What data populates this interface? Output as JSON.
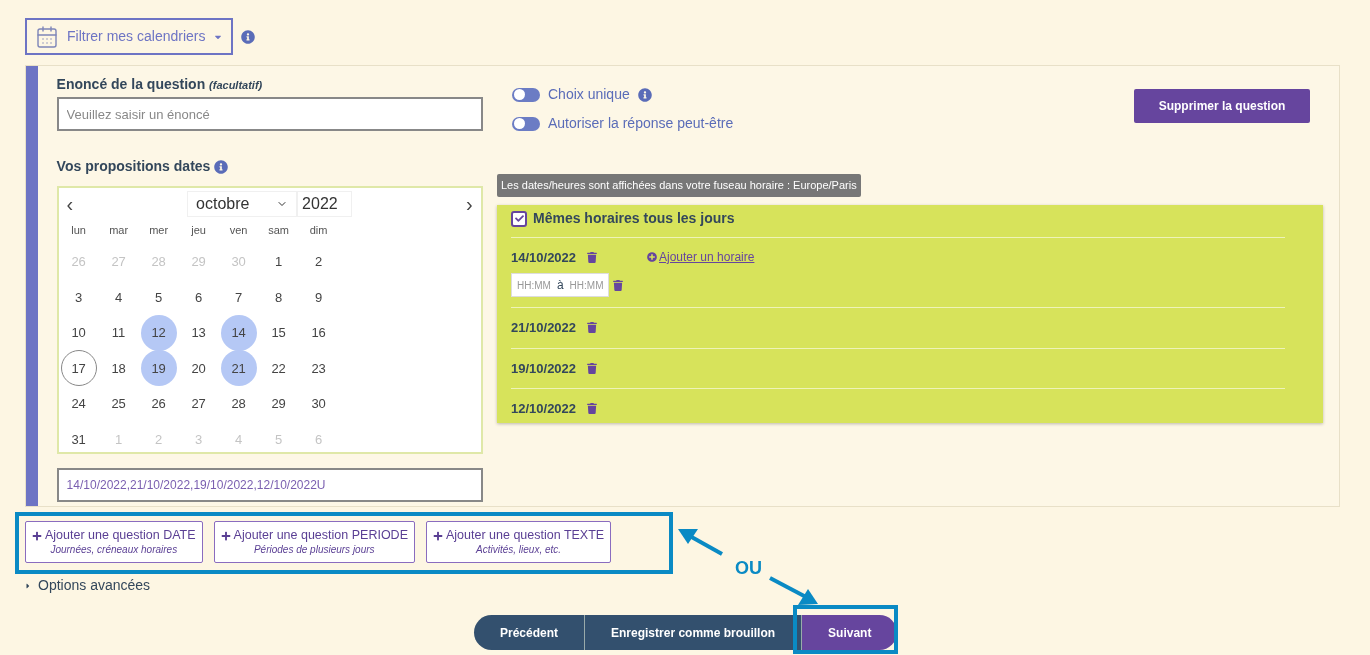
{
  "filter": {
    "label": "Filtrer mes calendriers"
  },
  "question": {
    "label": "Enoncé de la question",
    "hint": "(facultatif)",
    "placeholder": "Veuillez saisir un énoncé"
  },
  "toggles": [
    {
      "label": "Choix unique",
      "on": false,
      "info": true
    },
    {
      "label": "Autoriser la réponse peut-être",
      "on": false,
      "info": false
    }
  ],
  "delete_button": "Supprimer la question",
  "dates_label": "Vos propositions dates",
  "calendar": {
    "prev": "‹",
    "next": "›",
    "month": "octobre",
    "year": "2022",
    "weekdays": [
      "lun",
      "mar",
      "mer",
      "jeu",
      "ven",
      "sam",
      "dim"
    ],
    "days": [
      {
        "label": "26",
        "muted": true,
        "selected": false,
        "today": false
      },
      {
        "label": "27",
        "muted": true,
        "selected": false,
        "today": false
      },
      {
        "label": "28",
        "muted": true,
        "selected": false,
        "today": false
      },
      {
        "label": "29",
        "muted": true,
        "selected": false,
        "today": false
      },
      {
        "label": "30",
        "muted": true,
        "selected": false,
        "today": false
      },
      {
        "label": "1",
        "muted": false,
        "selected": false,
        "today": false
      },
      {
        "label": "2",
        "muted": false,
        "selected": false,
        "today": false
      },
      {
        "label": "3",
        "muted": false,
        "selected": false,
        "today": false
      },
      {
        "label": "4",
        "muted": false,
        "selected": false,
        "today": false
      },
      {
        "label": "5",
        "muted": false,
        "selected": false,
        "today": false
      },
      {
        "label": "6",
        "muted": false,
        "selected": false,
        "today": false
      },
      {
        "label": "7",
        "muted": false,
        "selected": false,
        "today": false
      },
      {
        "label": "8",
        "muted": false,
        "selected": false,
        "today": false
      },
      {
        "label": "9",
        "muted": false,
        "selected": false,
        "today": false
      },
      {
        "label": "10",
        "muted": false,
        "selected": false,
        "today": false
      },
      {
        "label": "11",
        "muted": false,
        "selected": false,
        "today": false
      },
      {
        "label": "12",
        "muted": false,
        "selected": true,
        "today": false
      },
      {
        "label": "13",
        "muted": false,
        "selected": false,
        "today": false
      },
      {
        "label": "14",
        "muted": false,
        "selected": true,
        "today": false
      },
      {
        "label": "15",
        "muted": false,
        "selected": false,
        "today": false
      },
      {
        "label": "16",
        "muted": false,
        "selected": false,
        "today": false
      },
      {
        "label": "17",
        "muted": false,
        "selected": false,
        "today": true
      },
      {
        "label": "18",
        "muted": false,
        "selected": false,
        "today": false
      },
      {
        "label": "19",
        "muted": false,
        "selected": true,
        "today": false
      },
      {
        "label": "20",
        "muted": false,
        "selected": false,
        "today": false
      },
      {
        "label": "21",
        "muted": false,
        "selected": true,
        "today": false
      },
      {
        "label": "22",
        "muted": false,
        "selected": false,
        "today": false
      },
      {
        "label": "23",
        "muted": false,
        "selected": false,
        "today": false
      },
      {
        "label": "24",
        "muted": false,
        "selected": false,
        "today": false
      },
      {
        "label": "25",
        "muted": false,
        "selected": false,
        "today": false
      },
      {
        "label": "26",
        "muted": false,
        "selected": false,
        "today": false
      },
      {
        "label": "27",
        "muted": false,
        "selected": false,
        "today": false
      },
      {
        "label": "28",
        "muted": false,
        "selected": false,
        "today": false
      },
      {
        "label": "29",
        "muted": false,
        "selected": false,
        "today": false
      },
      {
        "label": "30",
        "muted": false,
        "selected": false,
        "today": false
      },
      {
        "label": "31",
        "muted": false,
        "selected": false,
        "today": false
      },
      {
        "label": "1",
        "muted": true,
        "selected": false,
        "today": false
      },
      {
        "label": "2",
        "muted": true,
        "selected": false,
        "today": false
      },
      {
        "label": "3",
        "muted": true,
        "selected": false,
        "today": false
      },
      {
        "label": "4",
        "muted": true,
        "selected": false,
        "today": false
      },
      {
        "label": "5",
        "muted": true,
        "selected": false,
        "today": false
      },
      {
        "label": "6",
        "muted": true,
        "selected": false,
        "today": false
      }
    ]
  },
  "dates_value": "14/10/2022,21/10/2022,19/10/2022,12/10/2022U",
  "timezone_note": "Les dates/heures sont affichées dans votre fuseau horaire : Europe/Paris",
  "schedule": {
    "same_hours": {
      "label": "Mêmes horaires tous les jours",
      "checked": true
    },
    "dates": [
      {
        "date": "14/10/2022",
        "add_link": "Ajouter un horaire",
        "slots": [
          {
            "start": "HH:MM",
            "sep": "à",
            "end": "HH:MM"
          }
        ]
      },
      {
        "date": "21/10/2022"
      },
      {
        "date": "19/10/2022"
      },
      {
        "date": "12/10/2022"
      }
    ]
  },
  "add_buttons": [
    {
      "title": "Ajouter une question DATE",
      "subtitle": "Journées, créneaux horaires"
    },
    {
      "title": "Ajouter une question PERIODE",
      "subtitle": "Périodes de plusieurs jours"
    },
    {
      "title": "Ajouter une question TEXTE",
      "subtitle": "Activités, lieux, etc."
    }
  ],
  "advanced": {
    "label": "Options avancées",
    "expanded": false
  },
  "nav": [
    {
      "label": "Précédent",
      "kind": "secondary"
    },
    {
      "label": "Enregistrer comme brouillon",
      "kind": "secondary"
    },
    {
      "label": "Suivant",
      "kind": "primary"
    }
  ],
  "annotation": {
    "text": "OU"
  }
}
